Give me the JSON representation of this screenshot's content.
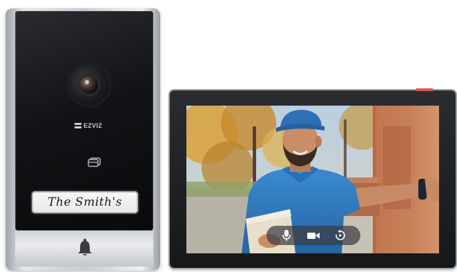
{
  "door_station": {
    "brand": "EZVIZ",
    "nameplate": "The Smith's",
    "icons": {
      "camera": "camera-lens-icon",
      "card_reader": "card-reader-icon",
      "doorbell": "bell-icon"
    }
  },
  "indoor_monitor": {
    "screen_subject": "delivery-person-video-feed",
    "controls": [
      {
        "icon": "microphone-icon"
      },
      {
        "icon": "video-camera-icon"
      },
      {
        "icon": "replay-icon"
      }
    ]
  },
  "colors": {
    "body_silver": "#c8ccd0",
    "glass_black": "#121316",
    "shirt_blue": "#2f7dc0",
    "cap_blue": "#2f6fb5",
    "accent_red": "#d85a54"
  }
}
